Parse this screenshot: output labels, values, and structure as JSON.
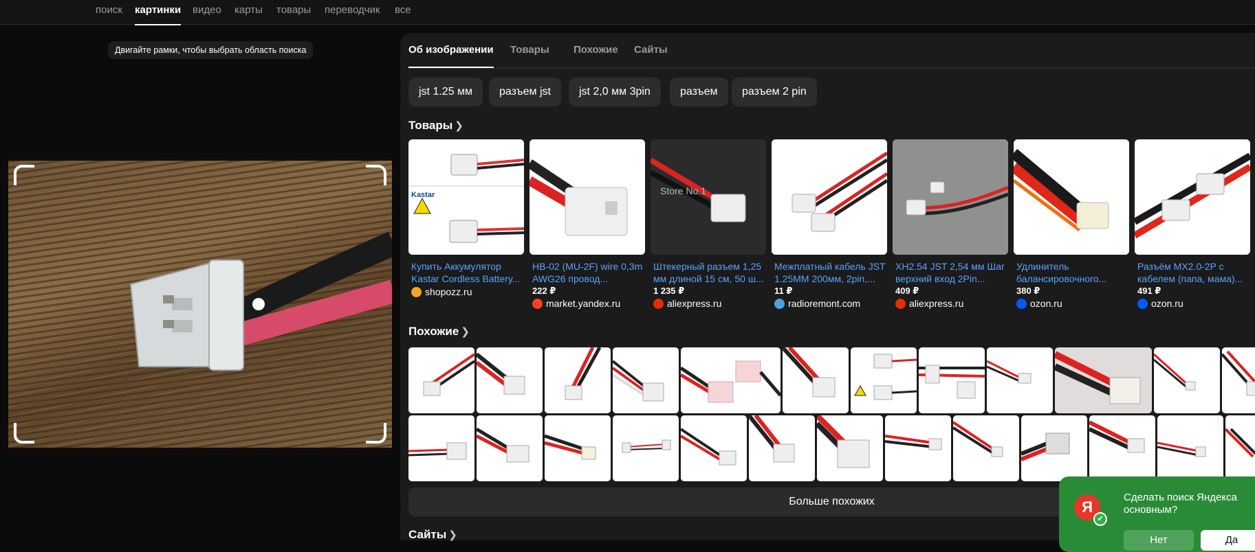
{
  "nav": {
    "tabs": [
      "поиск",
      "картинки",
      "видео",
      "карты",
      "товары",
      "переводчик",
      "все"
    ],
    "active": "картинки"
  },
  "left": {
    "hint": "Двигайте рамки, чтобы выбрать область поиска"
  },
  "right": {
    "tabs": [
      "Об изображении",
      "Товары",
      "Похожие",
      "Сайты"
    ],
    "chips": [
      "jst 1.25 мм",
      "разъем jst",
      "jst 2,0 мм 3pin",
      "разъем",
      "разъем 2 pin"
    ],
    "products_title": "Товары",
    "products": [
      {
        "name": "Купить Аккумулятор Kastar Cordless Battery...",
        "price": "",
        "store": "shopozz.ru",
        "store_color": "#f5a623"
      },
      {
        "name": "HB-02 (MU-2F) wire 0,3m AWG26 провод...",
        "price": "222 ₽",
        "store": "market.yandex.ru",
        "store_color": "#fc3f1d"
      },
      {
        "name": "Штекерный разъем 1,25 мм длиной 15 см, 50 ш...",
        "price": "1 235 ₽",
        "store": "aliexpress.ru",
        "store_color": "#e62e04"
      },
      {
        "name": "Межплатный кабель JST 1.25MM 200мм, 2pin,...",
        "price": "11 ₽",
        "store": "radioremont.com",
        "store_color": "#4aa3df"
      },
      {
        "name": "XH2.54 JST 2,54 мм Шаг верхний вход 2Pin...",
        "price": "409 ₽",
        "store": "aliexpress.ru",
        "store_color": "#e62e04"
      },
      {
        "name": "Удлинитель балансировочного...",
        "price": "380 ₽",
        "store": "ozon.ru",
        "store_color": "#005bff"
      },
      {
        "name": "Разъём MX2.0-2P с кабелем (папа, мама)...",
        "price": "491 ₽",
        "store": "ozon.ru",
        "store_color": "#005bff"
      }
    ],
    "product_watermark": "Store No.1",
    "kastar_label": "Kastar",
    "similar_title": "Похожие",
    "more_button": "Больше похожих",
    "sites_title": "Сайты"
  },
  "popup": {
    "logo": "Я",
    "text": "Сделать поиск Яндекса основным?",
    "no": "Нет",
    "yes": "Да"
  }
}
